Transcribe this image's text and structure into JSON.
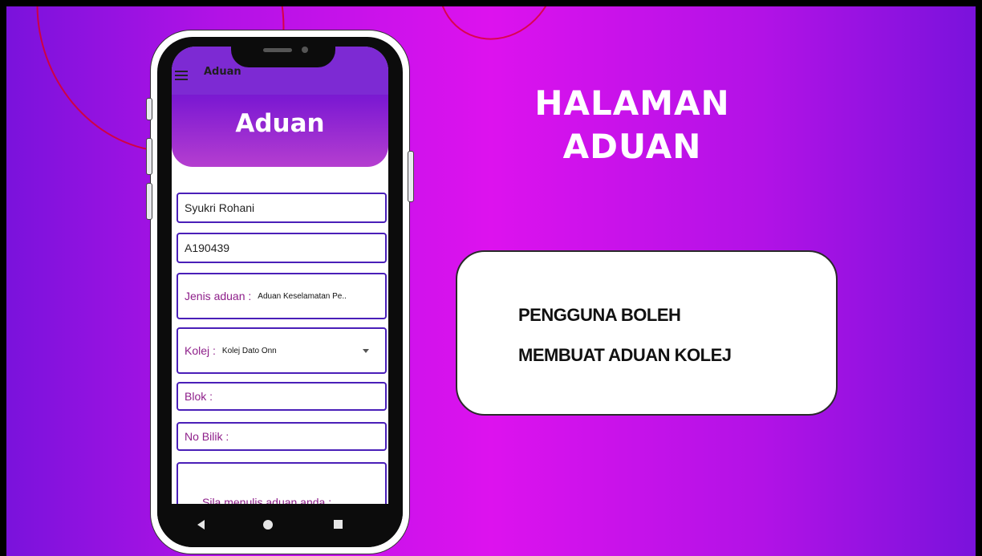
{
  "app": {
    "small_title": "Aduan",
    "title": "Aduan"
  },
  "form": {
    "name_value": "Syukri Rohani",
    "id_value": "A190439",
    "jenis_label": "Jenis aduan :",
    "jenis_value": "Aduan Keselamatan Pe..",
    "kolej_label": "Kolej :",
    "kolej_value": "Kolej Dato Onn",
    "blok_label": "Blok :",
    "bilik_label": "No Bilik :",
    "aduan_placeholder": "Sila menulis aduan anda :"
  },
  "slide": {
    "headline_line1": "HALAMAN",
    "headline_line2": "ADUAN",
    "info_line1": "PENGGUNA BOLEH",
    "info_line2": "MEMBUAT ADUAN KOLEJ"
  },
  "colors": {
    "background_center": "#dd12ee",
    "background_edge": "#7a12dc",
    "field_border": "#4a1fb8",
    "label_color": "#8e1f8a"
  },
  "icons": [
    "menu-icon",
    "dropdown-caret-icon",
    "nav-back-icon",
    "nav-home-icon",
    "nav-recent-icon"
  ]
}
